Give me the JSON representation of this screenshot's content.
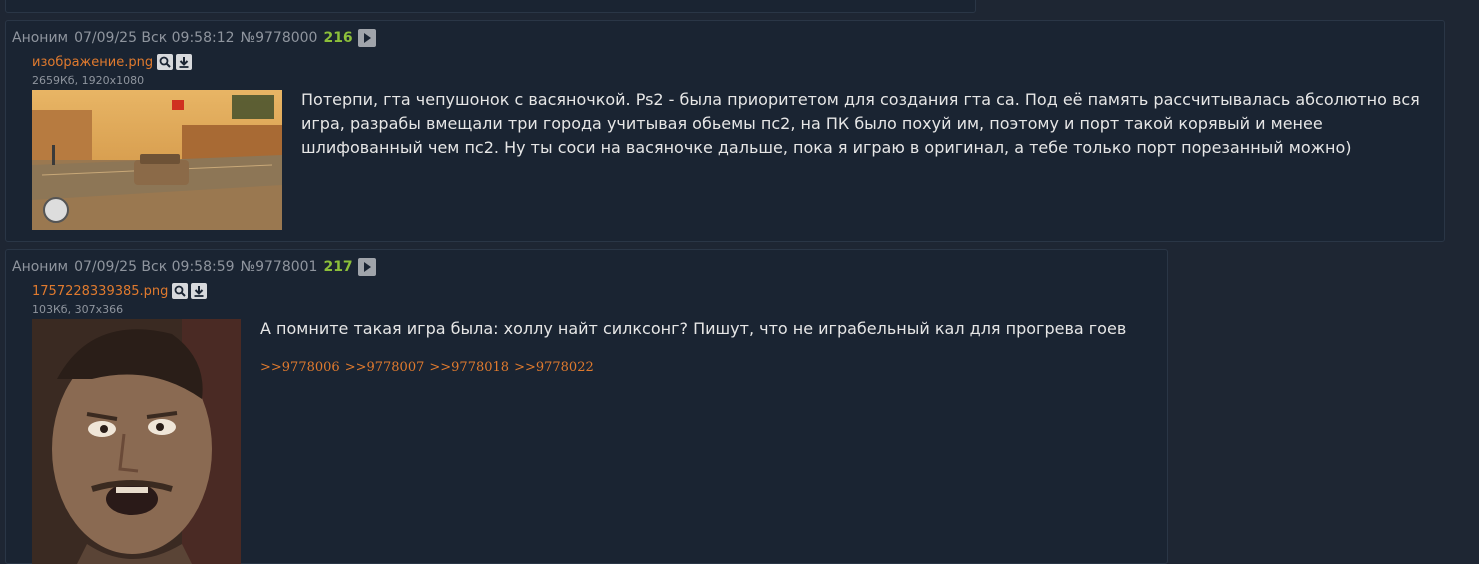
{
  "posts": [
    {
      "author": "Аноним",
      "date": "07/09/25 Вск 09:58:12",
      "number": "№9778000",
      "reply_index": "216",
      "file": {
        "name": "изображение.png",
        "meta": "2659Кб, 1920x1080"
      },
      "text": "Потерпи, гта чепушонок с васяночкой. Ps2 - была приоритетом для создания гта са. Под её память рассчитывалась абсолютно вся игра, разрабы вмещали три города учитывая обьемы пс2, на ПК было похуй им, поэтому и порт такой корявый и менее шлифованный чем пс2. Ну ты соси на васяночке дальше, пока я играю в оригинал, а тебе только порт порезанный можно)"
    },
    {
      "author": "Аноним",
      "date": "07/09/25 Вск 09:58:59",
      "number": "№9778001",
      "reply_index": "217",
      "file": {
        "name": "1757228339385.png",
        "meta": "103Кб, 307x366"
      },
      "text": "А помните такая игра была: холлу найт силксонг? Пишут, что не играбельный кал для прогрева гоев",
      "replies": [
        ">>9778006",
        ">>9778007",
        ">>9778018",
        ">>9778022"
      ]
    }
  ],
  "icons": {
    "play": "play-icon",
    "search": "magnifier-icon",
    "download": "download-icon"
  },
  "colors": {
    "link": "#e07a2e",
    "reply_index": "#8cbf3a",
    "background": "#1e2633",
    "post_bg": "#1a2432"
  }
}
